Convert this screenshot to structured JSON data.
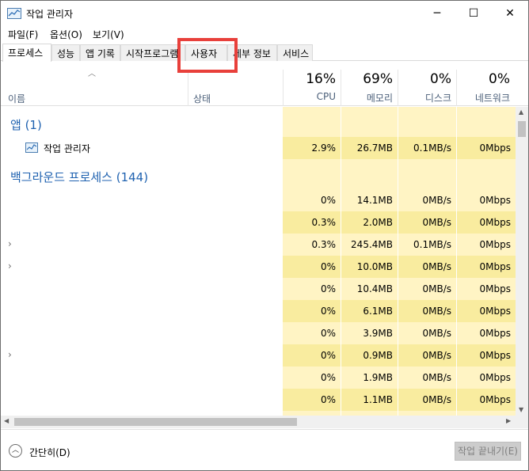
{
  "window": {
    "title": "작업 관리자",
    "minimize_glyph": "─",
    "maximize_glyph": "☐",
    "close_glyph": "✕"
  },
  "menu": [
    "파일(F)",
    "옵션(O)",
    "보기(V)"
  ],
  "tabs": [
    "프로세스",
    "성능",
    "앱 기록",
    "시작프로그램",
    "사용자",
    "세부 정보",
    "서비스"
  ],
  "active_tab": "프로세스",
  "highlighted_tab": "사용자",
  "accent_color": "#e8403b",
  "columns": {
    "name": "이름",
    "status": "상태",
    "metrics": [
      {
        "pct": "16%",
        "label": "CPU"
      },
      {
        "pct": "69%",
        "label": "메모리"
      },
      {
        "pct": "0%",
        "label": "디스크"
      },
      {
        "pct": "0%",
        "label": "네트워크"
      }
    ]
  },
  "groups": {
    "apps": "앱 (1)",
    "background": "백그라운드 프로세스 (144)"
  },
  "app_rows": [
    {
      "name": "작업 관리자",
      "cpu": "2.9%",
      "mem": "26.7MB",
      "disk": "0.1MB/s",
      "net": "0Mbps"
    }
  ],
  "background_rows": [
    {
      "expand": "",
      "cpu": "0%",
      "mem": "14.1MB",
      "disk": "0MB/s",
      "net": "0Mbps"
    },
    {
      "expand": "",
      "cpu": "0.3%",
      "mem": "2.0MB",
      "disk": "0MB/s",
      "net": "0Mbps"
    },
    {
      "expand": "›",
      "cpu": "0.3%",
      "mem": "245.4MB",
      "disk": "0.1MB/s",
      "net": "0Mbps"
    },
    {
      "expand": "›",
      "cpu": "0%",
      "mem": "10.0MB",
      "disk": "0MB/s",
      "net": "0Mbps"
    },
    {
      "expand": "",
      "cpu": "0%",
      "mem": "10.4MB",
      "disk": "0MB/s",
      "net": "0Mbps"
    },
    {
      "expand": "",
      "cpu": "0%",
      "mem": "6.1MB",
      "disk": "0MB/s",
      "net": "0Mbps"
    },
    {
      "expand": "",
      "cpu": "0%",
      "mem": "3.9MB",
      "disk": "0MB/s",
      "net": "0Mbps"
    },
    {
      "expand": "›",
      "cpu": "0%",
      "mem": "0.9MB",
      "disk": "0MB/s",
      "net": "0Mbps"
    },
    {
      "expand": "",
      "cpu": "0%",
      "mem": "1.9MB",
      "disk": "0MB/s",
      "net": "0Mbps"
    },
    {
      "expand": "",
      "cpu": "0%",
      "mem": "1.1MB",
      "disk": "0MB/s",
      "net": "0Mbps"
    }
  ],
  "footer": {
    "fewer_details": "간단히(D)",
    "end_task": "작업 끝내기(E)"
  }
}
